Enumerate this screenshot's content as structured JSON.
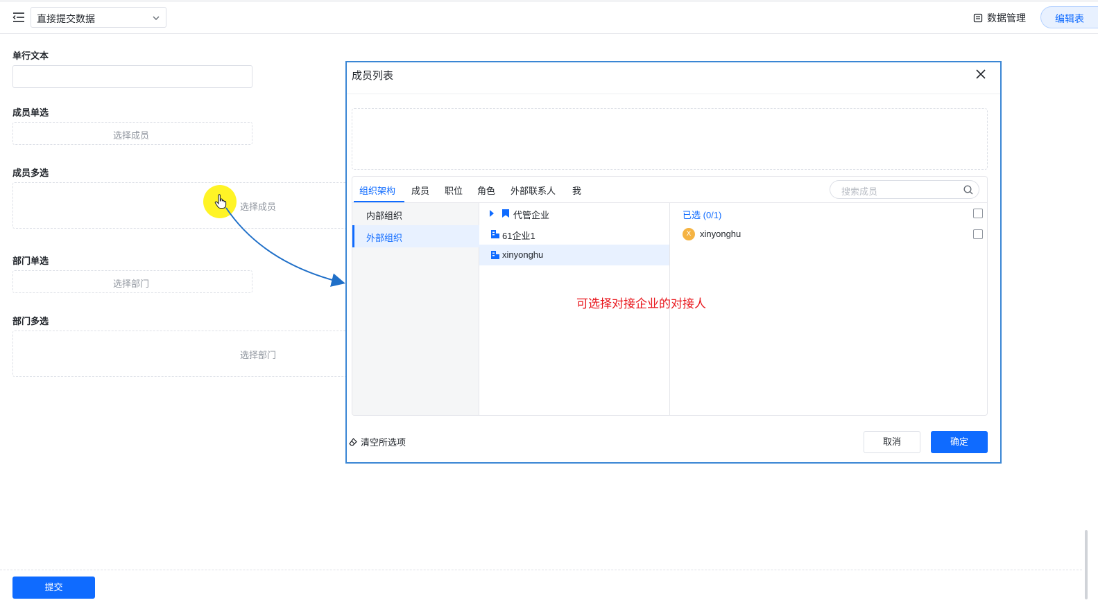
{
  "header": {
    "form_select_value": "直接提交数据",
    "data_management_label": "数据管理",
    "edit_button_label": "编辑表"
  },
  "form": {
    "fields": [
      {
        "label": "单行文本",
        "placeholder": ""
      },
      {
        "label": "成员单选",
        "placeholder": "选择成员"
      },
      {
        "label": "成员多选",
        "placeholder": "选择成员"
      },
      {
        "label": "部门单选",
        "placeholder": "选择部门"
      },
      {
        "label": "部门多选",
        "placeholder": "选择部门"
      }
    ],
    "submit_label": "提交"
  },
  "modal": {
    "title": "成员列表",
    "tabs": [
      "组织架构",
      "成员",
      "职位",
      "角色",
      "外部联系人",
      "我"
    ],
    "active_tab": "组织架构",
    "search_placeholder": "搜索成员",
    "org_categories": [
      "内部组织",
      "外部组织"
    ],
    "active_category": "外部组织",
    "org_tree": [
      {
        "label": "代管企业",
        "icon": "bookmark-icon",
        "expandable": true
      },
      {
        "label": "61企业1",
        "icon": "building-icon"
      },
      {
        "label": "xinyonghu",
        "icon": "building-icon",
        "selected": true
      }
    ],
    "selected_count_label": "已选 (0/1)",
    "members": [
      {
        "avatar_letter": "X",
        "name": "xinyonghu"
      }
    ],
    "clear_all_label": "清空所选项",
    "cancel_label": "取消",
    "confirm_label": "确定"
  },
  "annotation": {
    "text": "可选择对接企业的对接人",
    "color": "#e8151b"
  },
  "colors": {
    "primary": "#0f6bff",
    "modal_border": "#3a86d4",
    "cursor_highlight": "#fff200"
  }
}
